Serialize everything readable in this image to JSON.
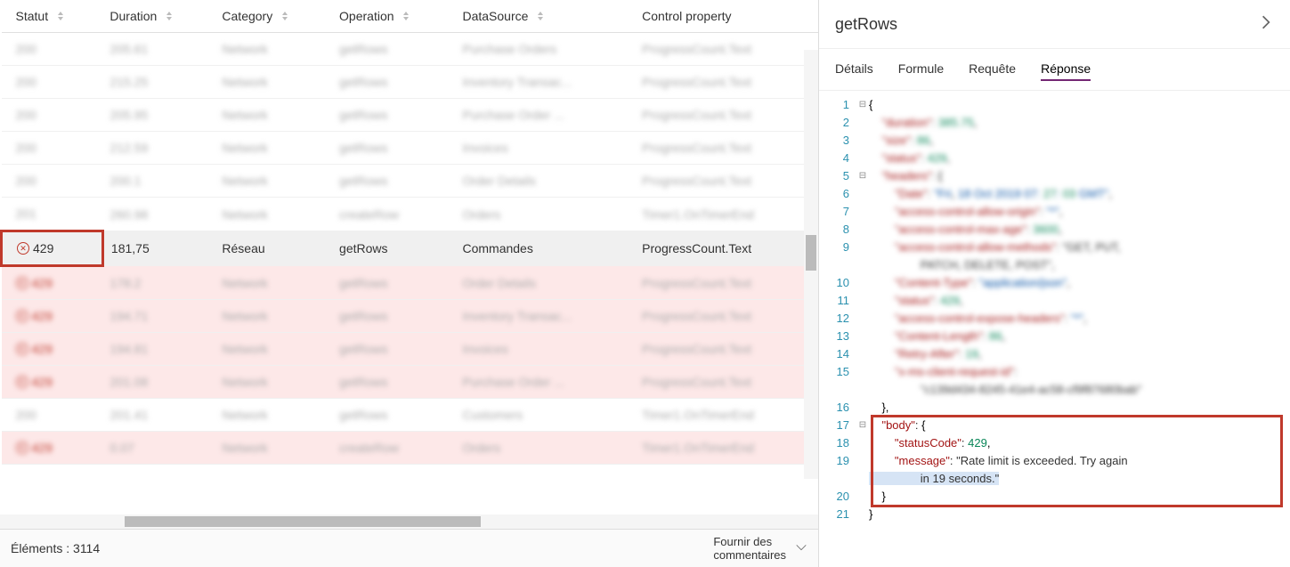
{
  "table": {
    "columns": [
      "Statut",
      "Duration",
      "Category",
      "Operation",
      "DataSource",
      "Control property"
    ],
    "rows": [
      {
        "status": "200",
        "duration": "205.61",
        "category": "Network",
        "operation": "getRows",
        "datasource": "Purchase Orders",
        "control": "ProgressCount.Text",
        "err": false,
        "blur": true
      },
      {
        "status": "200",
        "duration": "215.25",
        "category": "Network",
        "operation": "getRows",
        "datasource": "Inventory Transac...",
        "control": "ProgressCount.Text",
        "err": false,
        "blur": true
      },
      {
        "status": "200",
        "duration": "205.95",
        "category": "Network",
        "operation": "getRows",
        "datasource": "Purchase Order ...",
        "control": "ProgressCount.Text",
        "err": false,
        "blur": true
      },
      {
        "status": "200",
        "duration": "212.59",
        "category": "Network",
        "operation": "getRows",
        "datasource": "Invoices",
        "control": "ProgressCount.Text",
        "err": false,
        "blur": true
      },
      {
        "status": "200",
        "duration": "200.1",
        "category": "Network",
        "operation": "getRows",
        "datasource": "Order Details",
        "control": "ProgressCount.Text",
        "err": false,
        "blur": true
      },
      {
        "status": "201",
        "duration": "260.98",
        "category": "Network",
        "operation": "createRow",
        "datasource": "Orders",
        "control": "Timer1.OnTimerEnd",
        "err": false,
        "blur": true
      },
      {
        "status": "429",
        "duration": "181,75",
        "category": "Réseau",
        "operation": "getRows",
        "datasource": "Commandes",
        "control": "ProgressCount.Text",
        "err": true,
        "blur": false,
        "highlight": true
      },
      {
        "status": "429",
        "duration": "178.2",
        "category": "Network",
        "operation": "getRows",
        "datasource": "Order Details",
        "control": "ProgressCount.Text",
        "err": true,
        "blur": true
      },
      {
        "status": "429",
        "duration": "194.71",
        "category": "Network",
        "operation": "getRows",
        "datasource": "Inventory Transac...",
        "control": "ProgressCount.Text",
        "err": true,
        "blur": true
      },
      {
        "status": "429",
        "duration": "194.81",
        "category": "Network",
        "operation": "getRows",
        "datasource": "Invoices",
        "control": "ProgressCount.Text",
        "err": true,
        "blur": true
      },
      {
        "status": "429",
        "duration": "201.08",
        "category": "Network",
        "operation": "getRows",
        "datasource": "Purchase Order ...",
        "control": "ProgressCount.Text",
        "err": true,
        "blur": true
      },
      {
        "status": "200",
        "duration": "201.41",
        "category": "Network",
        "operation": "getRows",
        "datasource": "Customers",
        "control": "Timer1.OnTimerEnd",
        "err": false,
        "blur": true
      },
      {
        "status": "429",
        "duration": "0.07",
        "category": "Network",
        "operation": "createRow",
        "datasource": "Orders",
        "control": "Timer1.OnTimerEnd",
        "err": true,
        "blur": true
      }
    ],
    "item_count_label": "Éléments : 3114",
    "feedback_label": "Fournir des\ncommentaires"
  },
  "details": {
    "title": "getRows",
    "tabs": [
      "Détails",
      "Formule",
      "Requête",
      "Réponse"
    ],
    "active_tab": 3,
    "code": [
      {
        "n": 1,
        "fold": "⊟",
        "txt": "{",
        "cls": ""
      },
      {
        "n": 2,
        "fold": "",
        "txt": "    \"duration\": 385.75,",
        "cls": "blurc"
      },
      {
        "n": 3,
        "fold": "",
        "txt": "    \"size\": 86,",
        "cls": "blurc"
      },
      {
        "n": 4,
        "fold": "",
        "txt": "    \"status\": 429,",
        "cls": "blurc"
      },
      {
        "n": 5,
        "fold": "⊟",
        "txt": "    \"headers\": {",
        "cls": "blurc"
      },
      {
        "n": 6,
        "fold": "",
        "txt": "        \"Date\": \"Fri, 18 Oct 2019 07:27:03 GMT\",",
        "cls": "blurc"
      },
      {
        "n": 7,
        "fold": "",
        "txt": "        \"access-control-allow-origin\": \"*\",",
        "cls": "blurc"
      },
      {
        "n": 8,
        "fold": "",
        "txt": "        \"access-control-max-age\": 3600,",
        "cls": "blurc"
      },
      {
        "n": 9,
        "fold": "",
        "txt": "        \"access-control-allow-methods\": \"GET, PUT,\n                PATCH, DELETE, POST\",",
        "cls": "blurc"
      },
      {
        "n": 10,
        "fold": "",
        "txt": "        \"Content-Type\": \"application/json\",",
        "cls": "blurc"
      },
      {
        "n": 11,
        "fold": "",
        "txt": "        \"status\": 429,",
        "cls": "blurc"
      },
      {
        "n": 12,
        "fold": "",
        "txt": "        \"access-control-expose-headers\": \"*\",",
        "cls": "blurc"
      },
      {
        "n": 13,
        "fold": "",
        "txt": "        \"Content-Length\": 86,",
        "cls": "blurc"
      },
      {
        "n": 14,
        "fold": "",
        "txt": "        \"Retry-After\": 19,",
        "cls": "blurc"
      },
      {
        "n": 15,
        "fold": "",
        "txt": "        \"x-ms-client-request-id\":\n                \"c139d434-8245-41e4-ac58-cf9f87680bab\"",
        "cls": "blurc"
      },
      {
        "n": 16,
        "fold": "",
        "txt": "    },",
        "cls": ""
      },
      {
        "n": 17,
        "fold": "⊟",
        "txt": "    \"body\": {",
        "cls": "",
        "box": "start"
      },
      {
        "n": 18,
        "fold": "",
        "txt": "        \"statusCode\": 429,",
        "cls": ""
      },
      {
        "n": 19,
        "fold": "",
        "txt": "        \"message\": \"Rate limit is exceeded. Try again\n                in 19 seconds.\"",
        "cls": "",
        "hl": true
      },
      {
        "n": 20,
        "fold": "",
        "txt": "    }",
        "cls": "",
        "box": "end"
      },
      {
        "n": 21,
        "fold": "",
        "txt": "}",
        "cls": ""
      }
    ]
  }
}
